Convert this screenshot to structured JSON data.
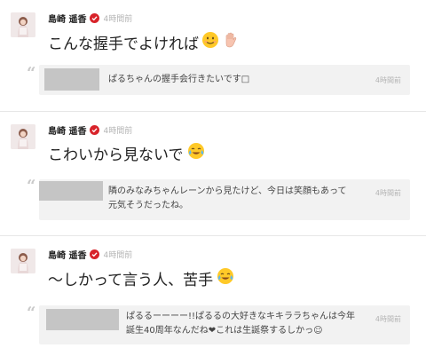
{
  "posts": [
    {
      "author": "島崎 遥香",
      "time": "4時間前",
      "message": "こんな握手でよければ",
      "message_emojis": [
        "smiling-face-icon",
        "raised-hand-icon"
      ],
      "reply": {
        "text": "ぱるちゃんの握手会行きたいです",
        "text_suffix": "□",
        "time": "4時間前"
      }
    },
    {
      "author": "島崎 遥香",
      "time": "4時間前",
      "message": "こわいから見ないで",
      "message_emojis": [
        "crying-laughing-face-icon"
      ],
      "reply": {
        "text_lines": [
          "隣のみなみちゃんレーンから見たけど、今日は笑顔もあって",
          "元気そうだったね。"
        ],
        "time": "4時間前"
      }
    },
    {
      "author": "島崎 遥香",
      "time": "4時間前",
      "message": "〜しかって言う人、苦手",
      "message_emojis": [
        "crying-laughing-face-icon"
      ],
      "reply": {
        "text_lines": [
          "ぱるるーーーー!!ぱるるの大好きなキキララちゃんは今年",
          "誕生40周年なんだね❤これは生誕祭するしかっ☺"
        ],
        "time": "4時間前"
      }
    }
  ],
  "colors": {
    "verified": "#d8232a",
    "reply_bg": "#f2f2f2",
    "thumb": "#c5c5c5",
    "emoji_yellow": "#ffc928"
  }
}
